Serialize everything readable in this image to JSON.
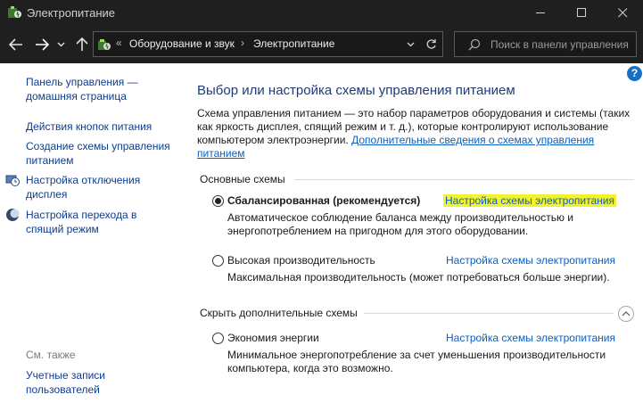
{
  "window": {
    "title": "Электропитание"
  },
  "address_bar": {
    "overflow": "«",
    "crumbs": [
      "Оборудование и звук",
      "Электропитание"
    ],
    "separator": "›"
  },
  "search": {
    "placeholder": "Поиск в панели управления"
  },
  "help": {
    "label": "?"
  },
  "sidebar": {
    "home_link": "Панель управления — домашняя страница",
    "links": [
      "Действия кнопок питания",
      "Создание схемы управления питанием",
      "Настройка отключения дисплея",
      "Настройка перехода в спящий режим"
    ],
    "see_also": "См. также",
    "see_also_links": [
      "Учетные записи пользователей"
    ]
  },
  "main": {
    "heading": "Выбор или настройка схемы управления питанием",
    "description": "Схема управления питанием — это набор параметров оборудования и системы (таких как яркость дисплея, спящий режим и т. д.), которые контролируют использование компьютером электроэнергии.",
    "description_link": "Дополнительные сведения о схемах управления питанием",
    "preferred_group": "Основные схемы",
    "hidden_group": "Скрыть дополнительные схемы",
    "plans": [
      {
        "name": "Сбалансированная (рекомендуется)",
        "link": "Настройка схемы электропитания",
        "description": "Автоматическое соблюдение баланса между производительностью и энергопотреблением на пригодном для этого оборудовании.",
        "selected": true
      },
      {
        "name": "Высокая производительность",
        "link": "Настройка схемы электропитания",
        "description": "Максимальная производительность (может потребоваться больше энергии).",
        "selected": false
      },
      {
        "name": "Экономия энергии",
        "link": "Настройка схемы электропитания",
        "description": "Минимальное энергопотребление за счет уменьшения производительности компьютера, когда это возможно.",
        "selected": false
      }
    ]
  },
  "colors": {
    "titlebar_bg": "#1f1f1f",
    "heading": "#1e3a78",
    "link": "#0b5fc2",
    "highlight": "#f4f22a"
  }
}
